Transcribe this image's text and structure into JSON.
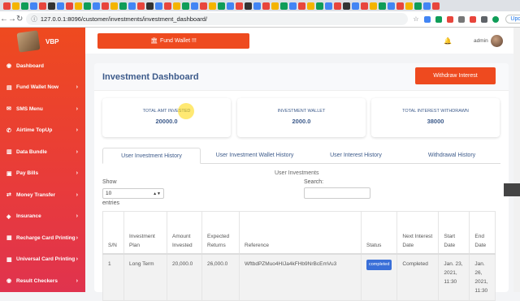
{
  "browser": {
    "url": "127.0.0.1:8096/customer/investments/investment_dashboard/",
    "update_label": "Update",
    "tab_colors": [
      "#e8453c",
      "#f4b400",
      "#0f9d58",
      "#4285f4",
      "#e8453c",
      "#333333",
      "#4285f4",
      "#e8453c",
      "#f4b400",
      "#0f9d58",
      "#4285f4",
      "#e8453c",
      "#f4b400",
      "#0f9d58",
      "#4285f4",
      "#e8453c",
      "#333333",
      "#4285f4",
      "#e8453c",
      "#f4b400",
      "#0f9d58",
      "#4285f4",
      "#e8453c",
      "#f4b400",
      "#0f9d58",
      "#4285f4",
      "#e8453c",
      "#333333",
      "#4285f4",
      "#e8453c",
      "#f4b400",
      "#0f9d58",
      "#4285f4",
      "#e8453c",
      "#f4b400",
      "#0f9d58",
      "#4285f4",
      "#e8453c",
      "#333333",
      "#4285f4",
      "#e8453c",
      "#f4b400",
      "#0f9d58",
      "#4285f4",
      "#e8453c",
      "#f4b400",
      "#0f9d58",
      "#4285f4",
      "#e8453c"
    ]
  },
  "brand": {
    "name": "VBP"
  },
  "sidebar": {
    "items": [
      {
        "label": "Dashboard",
        "icon": "dashboard-icon",
        "glyph": "◉",
        "chevron": false
      },
      {
        "label": "Fund Wallet Now",
        "icon": "wallet-icon",
        "glyph": "▤",
        "chevron": true
      },
      {
        "label": "SMS Menu",
        "icon": "sms-icon",
        "glyph": "✉",
        "chevron": true
      },
      {
        "label": "Airtime TopUp",
        "icon": "phone-icon",
        "glyph": "✆",
        "chevron": true
      },
      {
        "label": "Data Bundle",
        "icon": "data-icon",
        "glyph": "▥",
        "chevron": true
      },
      {
        "label": "Pay Bills",
        "icon": "bills-icon",
        "glyph": "▣",
        "chevron": true
      },
      {
        "label": "Money Transfer",
        "icon": "transfer-icon",
        "glyph": "⇄",
        "chevron": true
      },
      {
        "label": "Insurance",
        "icon": "insurance-icon",
        "glyph": "◈",
        "chevron": true
      },
      {
        "label": "Recharge Card Printing",
        "icon": "print-icon",
        "glyph": "▦",
        "chevron": true
      },
      {
        "label": "Universal Card Printing",
        "icon": "card-icon",
        "glyph": "▦",
        "chevron": true
      },
      {
        "label": "Result Checkers",
        "icon": "result-icon",
        "glyph": "◉",
        "chevron": true
      }
    ]
  },
  "topbar": {
    "fund_label": "Fund Wallet !!!",
    "admin_label": "admin"
  },
  "page": {
    "title": "Investment Dashboard",
    "withdraw_label": "Withdraw Interest",
    "stats": [
      {
        "label": "TOTAL AMT INVESTED",
        "value": "20000.0"
      },
      {
        "label": "INVESTMENT WALLET",
        "value": "2000.0"
      },
      {
        "label": "TOTAL INTEREST WITHDRAWN",
        "value": "38000"
      }
    ],
    "tabs": [
      {
        "label": "User Investment History",
        "active": true
      },
      {
        "label": "User Investment Wallet History",
        "active": false
      },
      {
        "label": "User Interest History",
        "active": false
      },
      {
        "label": "Withdrawal History",
        "active": false
      }
    ],
    "table_caption": "User Investments",
    "show_label": "Show",
    "show_value": "10",
    "entries_label": "entries",
    "search_label": "Search:",
    "columns": [
      "S/N",
      "Investment Plan",
      "Amount Invested",
      "Expected Returns",
      "Reference",
      "Status",
      "Next Interest Date",
      "Start Date",
      "End Date"
    ],
    "rows": [
      {
        "sn": "1",
        "plan": "Long Term",
        "amount": "20,000.0",
        "expected": "26,000.0",
        "reference": "WftbdPZMuo4HIJa4kFHb9NrBcEmVu3",
        "status": "completed",
        "next": "Completed",
        "start": "Jan. 23, 2021, 11:30",
        "end": "Jan. 26, 2021, 11:30"
      }
    ]
  }
}
